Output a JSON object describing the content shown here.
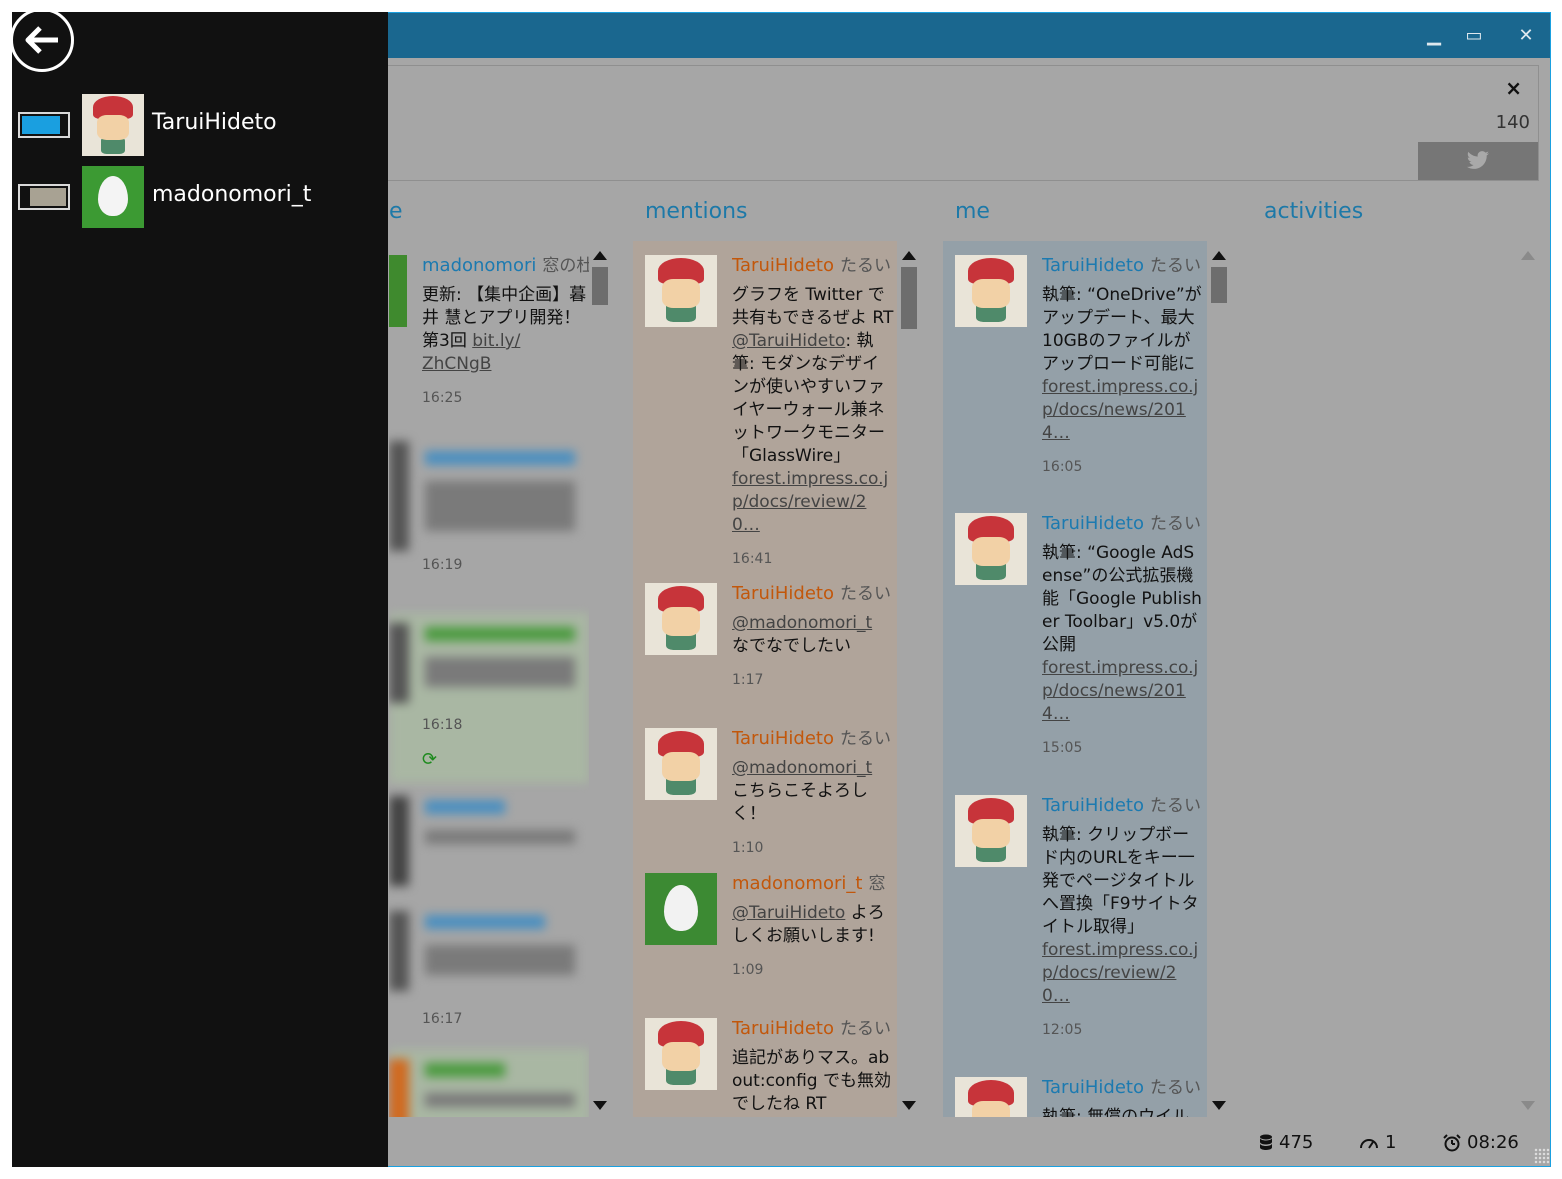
{
  "window": {
    "minimize": "▁",
    "maximize": "▭",
    "close": "✕"
  },
  "composer": {
    "close": "×",
    "remaining": "140",
    "tweet_icon": "twitter-bird-icon"
  },
  "columns": {
    "home_partial": "e",
    "mentions": "mentions",
    "me": "me",
    "activities": "activities"
  },
  "home_tweet": {
    "screen_name": "madonomori",
    "display_name": "窓の杜",
    "text": "更新: 【集中企画】暮井 慧とアプリ開発！第3回 ",
    "link1": "bit.ly/",
    "link2": "ZhCNgB",
    "time": "16:25",
    "times": [
      "16:19",
      "16:18",
      "16:17"
    ]
  },
  "mentions": [
    {
      "screen_name": "TaruiHideto",
      "display_name": "たるい",
      "text": "グラフを Twitter で共有もできるぜよ RT ",
      "mention": "@TaruiHideto",
      "text2": ": 執筆: モダンなデザインが使いやすいファイヤーウォール兼ネットワークモニター「GlassWire」",
      "link": "forest.impress.co.jp/docs/review/20…",
      "time": "16:41"
    },
    {
      "screen_name": "TaruiHideto",
      "display_name": "たるい",
      "mention": "@madonomori_t",
      "text2": " なでなでしたい",
      "time": "1:17"
    },
    {
      "screen_name": "TaruiHideto",
      "display_name": "たるい",
      "mention": "@madonomori_t",
      "text2": " こちらこそよろしく！",
      "time": "1:10"
    },
    {
      "screen_name": "madonomori_t",
      "display_name": "窓",
      "mention": "@TaruiHideto",
      "text2": " よろしくお願いします!",
      "time": "1:09"
    },
    {
      "screen_name": "TaruiHideto",
      "display_name": "たるい",
      "text2": "追記がありマス。about:config でも無効でしたね RT"
    }
  ],
  "me": [
    {
      "screen_name": "TaruiHideto",
      "display_name": "たるい",
      "text": "執筆: “OneDrive”がアップデート、最大10GBのファイルがアップロード可能に",
      "link": "forest.impress.co.jp/docs/news/2014…",
      "time": "16:05"
    },
    {
      "screen_name": "TaruiHideto",
      "display_name": "たるい",
      "text": "執筆: “Google AdSense”の公式拡張機能「Google Publisher Toolbar」v5.0が公開",
      "link": "forest.impress.co.jp/docs/news/2014…",
      "time": "15:05"
    },
    {
      "screen_name": "TaruiHideto",
      "display_name": "たるい",
      "text": "執筆: クリップボード内のURLをキー一発でページタイトルへ置換「F9サイトタイトル取得」",
      "link": "forest.impress.co.jp/docs/review/20…",
      "time": "12:05"
    },
    {
      "screen_name": "TaruiHideto",
      "display_name": "たるい",
      "text": "執筆: 無償のウイルス"
    }
  ],
  "status": {
    "cache_count": "475",
    "connections": "1",
    "clock": "08:26"
  },
  "accounts": [
    {
      "name": "TaruiHideto",
      "active": true
    },
    {
      "name": "madonomori_t",
      "active": false
    }
  ],
  "colors": {
    "titlebar": "#1a678f",
    "accent": "#1aa0e0",
    "mentions_bg": "#b0a49a",
    "me_bg": "#94a0a8"
  }
}
